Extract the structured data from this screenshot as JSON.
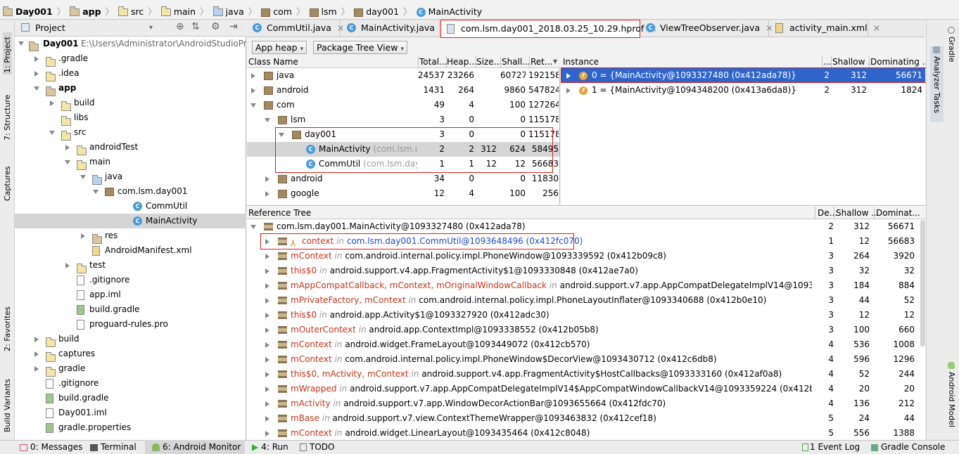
{
  "breadcrumbs": [
    "Day001",
    "app",
    "src",
    "main",
    "java",
    "com",
    "lsm",
    "day001",
    "MainActivity"
  ],
  "project_panel": {
    "header": "Project",
    "root_name": "Day001",
    "root_path": "E:\\Users\\Administrator\\AndroidStudioPr",
    "items": [
      ".gradle",
      ".idea",
      "app",
      "build",
      "libs",
      "src",
      "androidTest",
      "main",
      "java",
      "com.lsm.day001",
      "CommUtil",
      "MainActivity",
      "res",
      "AndroidManifest.xml",
      "test",
      ".gitignore",
      "app.iml",
      "build.gradle",
      "proguard-rules.pro",
      "build",
      "captures",
      "gradle",
      ".gitignore",
      "build.gradle",
      "Day001.iml",
      "gradle.properties"
    ]
  },
  "editor_tabs": [
    "CommUtil.java",
    "MainActivity.java",
    "com.lsm.day001_2018.03.25_10.29.hprof",
    "ViewTreeObserver.java",
    "activity_main.xml"
  ],
  "toolbar": {
    "heap_dropdown": "App heap",
    "view_dropdown": "Package Tree View"
  },
  "class_table": {
    "columns": [
      "Class Name",
      "Total...",
      "Heap...",
      "Size...",
      "Shall...",
      "Ret..."
    ],
    "rows": [
      {
        "name": "java",
        "hint": "",
        "total": "24537",
        "heap": "23266",
        "size": "",
        "shallow": "607270",
        "retained": "192158"
      },
      {
        "name": "android",
        "hint": "",
        "total": "1431",
        "heap": "264",
        "size": "",
        "shallow": "9860",
        "retained": "547824"
      },
      {
        "name": "com",
        "hint": "",
        "total": "49",
        "heap": "4",
        "size": "",
        "shallow": "100",
        "retained": "127264"
      },
      {
        "name": "lsm",
        "hint": "",
        "total": "3",
        "heap": "0",
        "size": "",
        "shallow": "0",
        "retained": "115178"
      },
      {
        "name": "day001",
        "hint": "",
        "total": "3",
        "heap": "0",
        "size": "",
        "shallow": "0",
        "retained": "115178"
      },
      {
        "name": "MainActivity",
        "hint": "(com.lsm.da",
        "total": "2",
        "heap": "2",
        "size": "312",
        "shallow": "624",
        "retained": "58495"
      },
      {
        "name": "CommUtil",
        "hint": "(com.lsm.day0",
        "total": "1",
        "heap": "1",
        "size": "12",
        "shallow": "12",
        "retained": "56683"
      },
      {
        "name": "android",
        "hint": "",
        "total": "34",
        "heap": "0",
        "size": "",
        "shallow": "0",
        "retained": "11830"
      },
      {
        "name": "google",
        "hint": "",
        "total": "12",
        "heap": "4",
        "size": "",
        "shallow": "100",
        "retained": "256"
      }
    ]
  },
  "instance_table": {
    "columns": [
      "Instance",
      "...",
      "Shallow ...",
      "Dominating ..."
    ],
    "rows": [
      {
        "text": "0 = {MainActivity@1093327480 (0x412ada78)}",
        "depth": "2",
        "shallow": "312",
        "dominating": "56671"
      },
      {
        "text": "1 = {MainActivity@1094348200 (0x413a6da8)}",
        "depth": "2",
        "shallow": "312",
        "dominating": "1824"
      }
    ]
  },
  "ref_tree": {
    "header": "Reference Tree",
    "columns": [
      "De...",
      "Shallow ...",
      "Dominat..."
    ],
    "root": {
      "text": "com.lsm.day001.MainActivity@1093327480 (0x412ada78)",
      "depth": "2",
      "shallow": "312",
      "dominating": "56671"
    },
    "rows": [
      {
        "field": "context",
        "in": "in",
        "target": "com.lsm.day001.CommUtil@1093648496 (0x412fc070)",
        "depth": "1",
        "shallow": "12",
        "dominating": "56683"
      },
      {
        "field": "mContext",
        "in": "in",
        "target": "com.android.internal.policy.impl.PhoneWindow@1093339592 (0x412b09c8)",
        "depth": "3",
        "shallow": "264",
        "dominating": "3920"
      },
      {
        "field": "this$0",
        "in": "in",
        "target": "android.support.v4.app.FragmentActivity$1@1093330848 (0x412ae7a0)",
        "depth": "3",
        "shallow": "32",
        "dominating": "32"
      },
      {
        "field": "mAppCompatCallback, mContext, mOriginalWindowCallback",
        "in": "in",
        "target": "android.support.v7.app.AppCompatDelegateImplV14@1093350",
        "depth": "3",
        "shallow": "184",
        "dominating": "884"
      },
      {
        "field": "mPrivateFactory, mContext",
        "in": "in",
        "target": "com.android.internal.policy.impl.PhoneLayoutInflater@1093340688 (0x412b0e10)",
        "depth": "3",
        "shallow": "44",
        "dominating": "52"
      },
      {
        "field": "this$0",
        "in": "in",
        "target": "android.app.Activity$1@1093327920 (0x412adc30)",
        "depth": "3",
        "shallow": "12",
        "dominating": "12"
      },
      {
        "field": "mOuterContext",
        "in": "in",
        "target": "android.app.ContextImpl@1093338552 (0x412b05b8)",
        "depth": "3",
        "shallow": "100",
        "dominating": "660"
      },
      {
        "field": "mContext",
        "in": "in",
        "target": "android.widget.FrameLayout@1093449072 (0x412cb570)",
        "depth": "4",
        "shallow": "536",
        "dominating": "1008"
      },
      {
        "field": "mContext",
        "in": "in",
        "target": "com.android.internal.policy.impl.PhoneWindow$DecorView@1093430712 (0x412c6db8)",
        "depth": "4",
        "shallow": "596",
        "dominating": "1296"
      },
      {
        "field": "this$0, mActivity, mContext",
        "in": "in",
        "target": "android.support.v4.app.FragmentActivity$HostCallbacks@1093333160 (0x412af0a8)",
        "depth": "4",
        "shallow": "52",
        "dominating": "244"
      },
      {
        "field": "mWrapped",
        "in": "in",
        "target": "android.support.v7.app.AppCompatDelegateImplV14$AppCompatWindowCallbackV14@1093359224 (0x412b567",
        "depth": "4",
        "shallow": "20",
        "dominating": "20"
      },
      {
        "field": "mActivity",
        "in": "in",
        "target": "android.support.v7.app.WindowDecorActionBar@1093655664 (0x412fdc70)",
        "depth": "4",
        "shallow": "136",
        "dominating": "212"
      },
      {
        "field": "mBase",
        "in": "in",
        "target": "android.support.v7.view.ContextThemeWrapper@1093463832 (0x412cef18)",
        "depth": "5",
        "shallow": "24",
        "dominating": "44"
      },
      {
        "field": "mContext",
        "in": "in",
        "target": "android.widget.LinearLayout@1093435464 (0x412c8048)",
        "depth": "5",
        "shallow": "556",
        "dominating": "1388"
      }
    ]
  },
  "left_side_tabs": [
    "1: Project",
    "7: Structure",
    "Captures",
    "2: Favorites",
    "Build Variants"
  ],
  "right_side_tabs": [
    "Gradle",
    "Analyzer Tasks",
    "Android Model"
  ],
  "bottom_tabs": [
    "0: Messages",
    "Terminal",
    "6: Android Monitor",
    "4: Run",
    "TODO",
    "1 Event Log",
    "Gradle Console"
  ]
}
